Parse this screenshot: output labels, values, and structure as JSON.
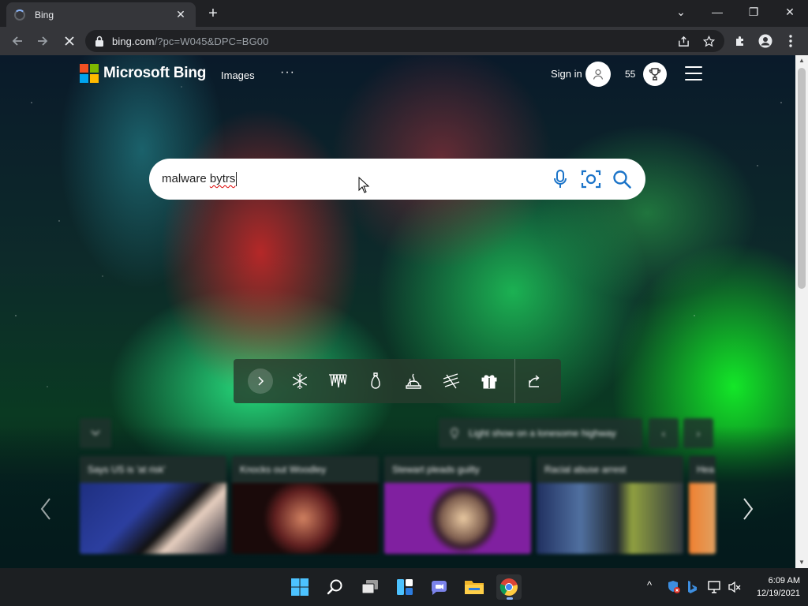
{
  "browser": {
    "tab_title": "Bing",
    "tab_close": "✕",
    "new_tab": "+",
    "url_host": "bing.com",
    "url_path": "/?pc=W045&DPC=BG00",
    "window_controls": [
      "⌄",
      "—",
      "❐",
      "✕"
    ]
  },
  "bing": {
    "logo_text": "Microsoft Bing",
    "nav_images": "Images",
    "nav_more": "···",
    "sign_in": "Sign in",
    "rewards_points": "55",
    "logo_colors": [
      "#f25022",
      "#7fba00",
      "#00a4ef",
      "#ffb900"
    ]
  },
  "search": {
    "text_plain": "malware ",
    "text_misspelled": "bytrs"
  },
  "theme_icons": [
    "chevron-right-icon",
    "snowflake-icon",
    "icicles-icon",
    "ornament-icon",
    "fireplace-icon",
    "sled-icon",
    "gift-icon",
    "share-icon"
  ],
  "image_caption": "Light show on a lonesome highway",
  "news": [
    {
      "title": "Says US is 'at risk'"
    },
    {
      "title": "Knocks out Woodley"
    },
    {
      "title": "Stewart pleads guilty"
    },
    {
      "title": "Racial abuse arrest"
    },
    {
      "title": "Hea"
    }
  ],
  "clock": {
    "time": "6:09 AM",
    "date": "12/19/2021"
  },
  "tray": {
    "chevron": "^"
  }
}
